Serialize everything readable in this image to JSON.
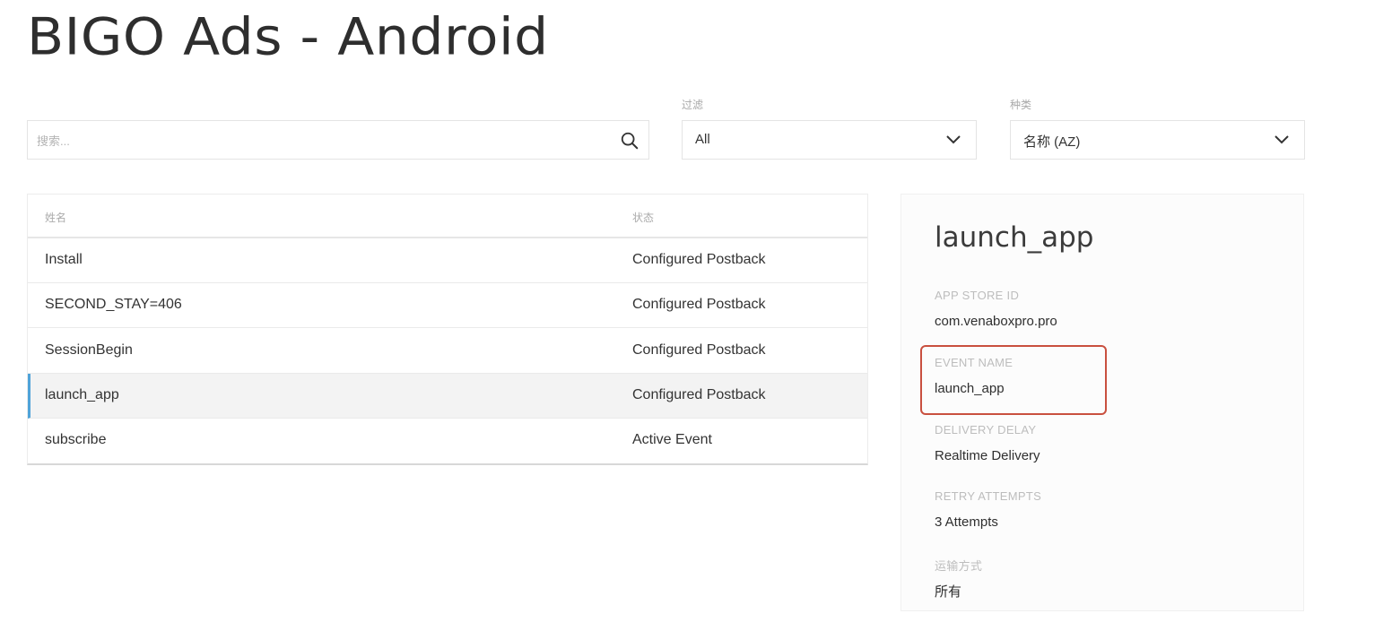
{
  "app": {
    "title": "BIGO Ads - Android"
  },
  "filters": {
    "search_placeholder": "搜索...",
    "filter_label": "过滤",
    "filter_value": "All",
    "sort_label": "种类",
    "sort_value": "名称 (AZ)"
  },
  "table": {
    "columns": [
      "姓名",
      "状态"
    ],
    "rows": [
      {
        "name": "Install",
        "status": "Configured Postback"
      },
      {
        "name": "SECOND_STAY=406",
        "status": "Configured Postback"
      },
      {
        "name": "SessionBegin",
        "status": "Configured Postback"
      },
      {
        "name": "launch_app",
        "status": "Configured Postback"
      },
      {
        "name": "subscribe",
        "status": "Active Event"
      }
    ],
    "selected_row": "launch_app"
  },
  "detail": {
    "title": "launch_app",
    "app_store_id_label": "APP STORE ID",
    "app_store_id": "com.venaboxpro.pro",
    "event_name_label": "EVENT NAME",
    "event_name": "launch_app",
    "delivery_delay_label": "DELIVERY DELAY",
    "delivery_delay": "Realtime Delivery",
    "retry_attempts_label": "RETRY ATTEMPTS",
    "retry_attempts": "3 Attempts",
    "transport_label": "运输方式",
    "transport": "所有"
  },
  "colors": {
    "selected_accent": "#4fa3d9",
    "highlight_border": "#c9503f"
  },
  "icons": {
    "search": "search-icon",
    "filter_dropdown": "chevron-down-icon",
    "sort_dropdown": "chevron-down-icon"
  }
}
